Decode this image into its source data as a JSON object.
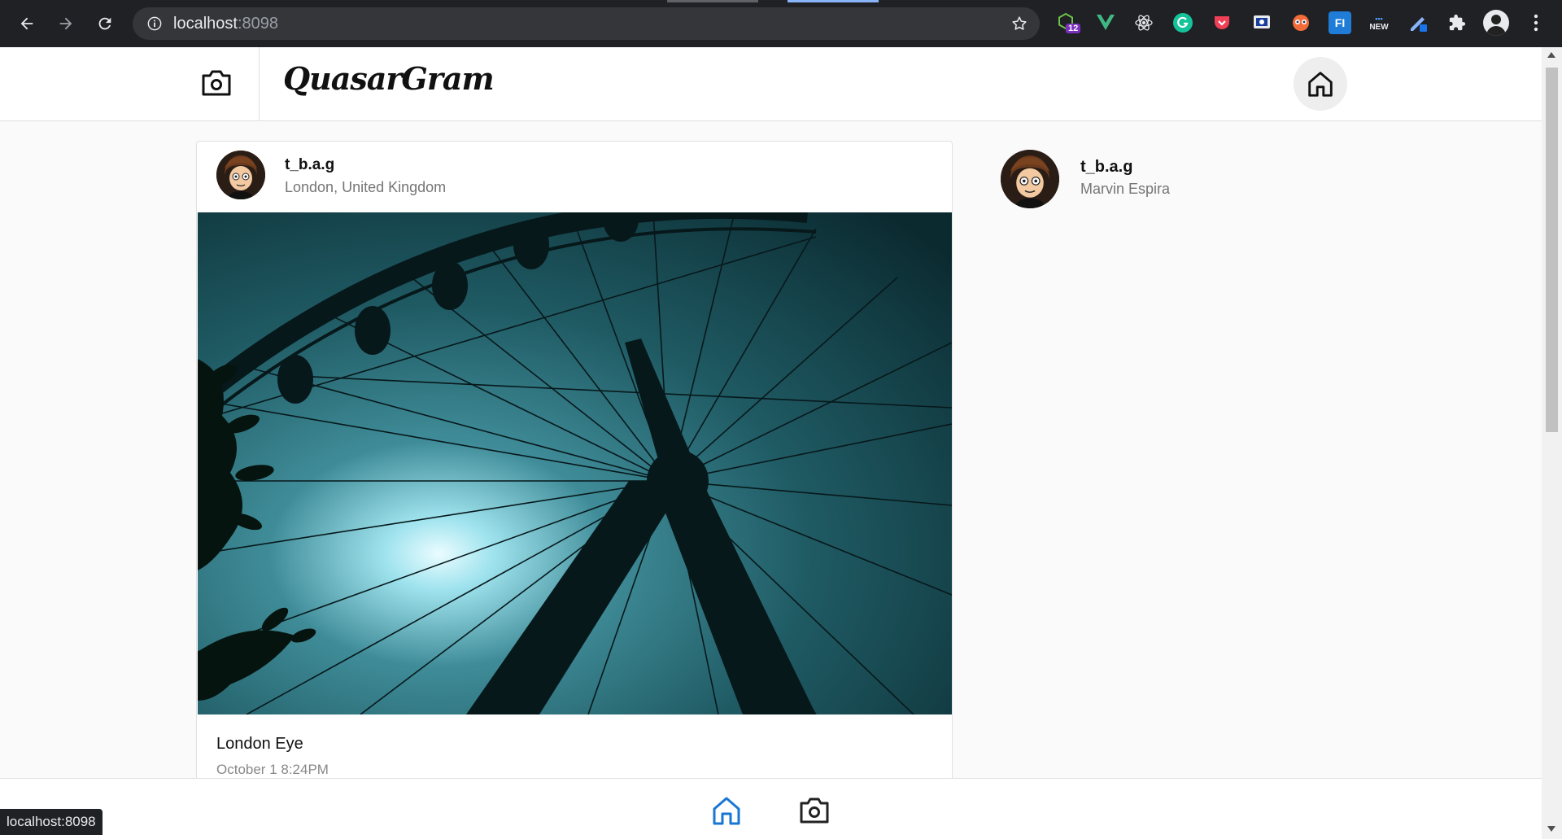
{
  "browser": {
    "url_host": "localhost",
    "url_port": ":8098",
    "extension_badge": "12",
    "ext_new_label": "NEW",
    "ext_fi_label": "FI"
  },
  "header": {
    "logo_text": "QuasarGram"
  },
  "post": {
    "username": "t_b.a.g",
    "location": "London, United Kingdom",
    "caption": "London Eye",
    "date": "October 1 8:24PM"
  },
  "sidebar": {
    "username": "t_b.a.g",
    "full_name": "Marvin Espira"
  },
  "status_bar": {
    "text": "localhost:8098"
  },
  "colors": {
    "accent": "#1976d2",
    "chrome": "#202124",
    "photo_tint": "#1f5a63"
  },
  "icons": {
    "header_left": "camera-icon",
    "header_right": "home-icon",
    "footer_home": "home-icon",
    "footer_camera": "camera-icon"
  }
}
